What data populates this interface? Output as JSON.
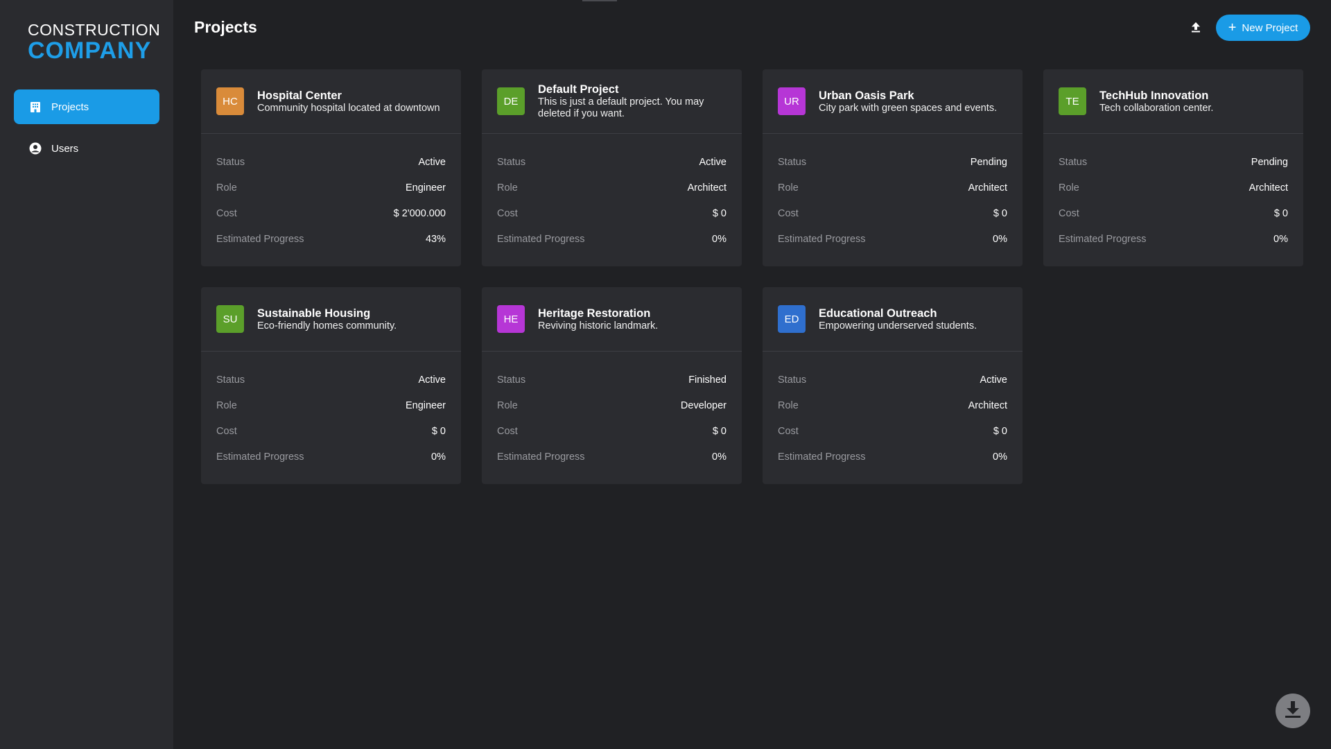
{
  "brand": {
    "line1": "CONSTRUCTION",
    "line2": "COMPANY"
  },
  "sidebar": {
    "items": [
      {
        "label": "Projects",
        "icon": "building-icon",
        "active": true
      },
      {
        "label": "Users",
        "icon": "user-circle-icon",
        "active": false
      }
    ]
  },
  "header": {
    "title": "Projects",
    "new_project_label": "New Project",
    "upload_icon": "upload-icon"
  },
  "labels": {
    "status": "Status",
    "role": "Role",
    "cost": "Cost",
    "progress": "Estimated Progress"
  },
  "projects": [
    {
      "initials": "HC",
      "color": "#d98b3a",
      "name": "Hospital Center",
      "description": "Community hospital located at downtown",
      "status": "Active",
      "role": "Engineer",
      "cost": "$ 2'000.000",
      "progress": "43%"
    },
    {
      "initials": "DE",
      "color": "#5b9f2a",
      "name": "Default Project",
      "description": "This is just a default project. You may deleted if you want.",
      "status": "Active",
      "role": "Architect",
      "cost": "$ 0",
      "progress": "0%"
    },
    {
      "initials": "UR",
      "color": "#b636d6",
      "name": "Urban Oasis Park",
      "description": "City park with green spaces and events.",
      "status": "Pending",
      "role": "Architect",
      "cost": "$ 0",
      "progress": "0%"
    },
    {
      "initials": "TE",
      "color": "#5b9f2a",
      "name": "TechHub Innovation",
      "description": "Tech collaboration center.",
      "status": "Pending",
      "role": "Architect",
      "cost": "$ 0",
      "progress": "0%"
    },
    {
      "initials": "SU",
      "color": "#5b9f2a",
      "name": "Sustainable Housing",
      "description": "Eco-friendly homes community.",
      "status": "Active",
      "role": "Engineer",
      "cost": "$ 0",
      "progress": "0%"
    },
    {
      "initials": "HE",
      "color": "#b636d6",
      "name": "Heritage Restoration",
      "description": "Reviving historic landmark.",
      "status": "Finished",
      "role": "Developer",
      "cost": "$ 0",
      "progress": "0%"
    },
    {
      "initials": "ED",
      "color": "#2f6fce",
      "name": "Educational Outreach",
      "description": "Empowering underserved students.",
      "status": "Active",
      "role": "Architect",
      "cost": "$ 0",
      "progress": "0%"
    }
  ],
  "footer": {
    "download_icon": "download-icon"
  },
  "colors": {
    "accent": "#1a9be6",
    "background": "#202124",
    "sidebar": "#2a2b2f",
    "card": "#2b2c30"
  }
}
